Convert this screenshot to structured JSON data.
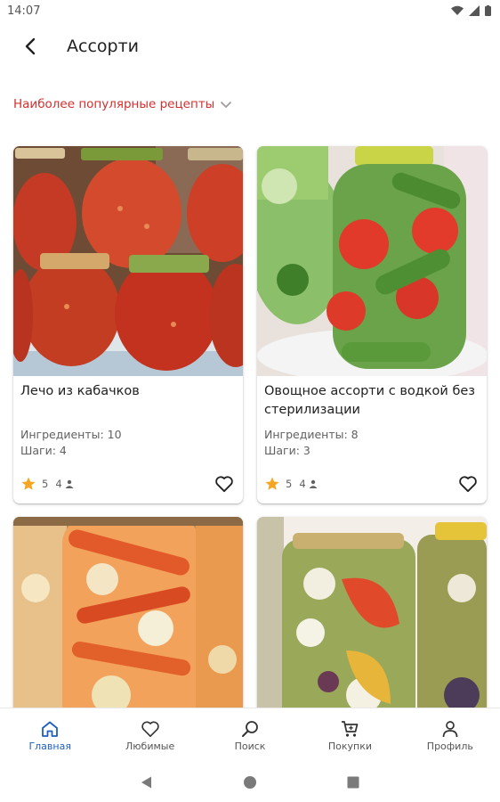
{
  "status": {
    "time": "14:07"
  },
  "app_bar": {
    "title": "Ассорти"
  },
  "filter": {
    "label": "Наиболее популярные рецепты"
  },
  "recipes": [
    {
      "title": "Лечо из кабачков",
      "ingredients": "Ингредиенты: 10",
      "steps": "Шаги: 4",
      "rating": "5",
      "reviews": "4"
    },
    {
      "title": "Овощное ассорти с водкой без стерилизации",
      "ingredients": "Ингредиенты: 8",
      "steps": "Шаги: 3",
      "rating": "5",
      "reviews": "4"
    },
    {
      "title": "",
      "ingredients": "",
      "steps": "",
      "rating": "",
      "reviews": ""
    },
    {
      "title": "",
      "ingredients": "",
      "steps": "",
      "rating": "",
      "reviews": ""
    }
  ],
  "bottom_nav": [
    {
      "label": "Главная",
      "icon": "home-icon",
      "active": true
    },
    {
      "label": "Любимые",
      "icon": "heart-icon",
      "active": false
    },
    {
      "label": "Поиск",
      "icon": "search-icon",
      "active": false
    },
    {
      "label": "Покупки",
      "icon": "cart-icon",
      "active": false
    },
    {
      "label": "Профиль",
      "icon": "person-icon",
      "active": false
    }
  ],
  "colors": {
    "accent": "#d32f2f",
    "nav_active": "#1e5fbf",
    "star": "#f5a623"
  }
}
